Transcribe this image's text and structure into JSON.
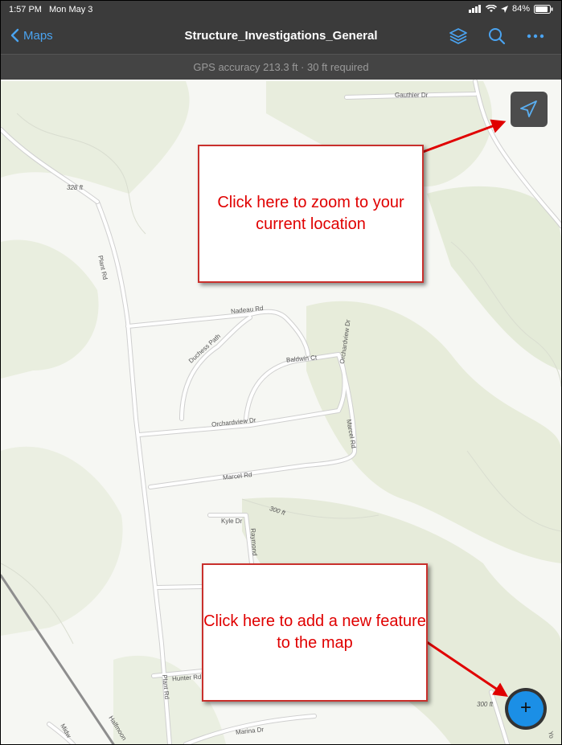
{
  "status_bar": {
    "time": "1:57 PM",
    "date": "Mon May 3",
    "battery": "84%"
  },
  "nav": {
    "back_label": "Maps",
    "title": "Structure_Investigations_General"
  },
  "gps": {
    "text": "GPS accuracy 213.3 ft  ·  30 ft required"
  },
  "map": {
    "roads": [
      "Gauthier Dr",
      "Plant Rd",
      "Nadeau Rd",
      "Duchess Path",
      "Baldwin Ct",
      "Orchardview Dr",
      "Orchardview Dr",
      "Marcel Rd",
      "Marcel Rd",
      "Kyle Dr",
      "Raymond",
      "Hunter Rd",
      "Plant Rd",
      "Marina Dr",
      "Halfmoon",
      "Midw",
      "Yo"
    ],
    "elevations": [
      "328 ft",
      "300 ft",
      "300 ft"
    ]
  },
  "callouts": {
    "locate": "Click here to zoom to your current location",
    "add": "Click here to add a new feature to the map"
  },
  "buttons": {
    "add_symbol": "+"
  },
  "colors": {
    "accent": "#1b8fe6",
    "annotation": "#e00000"
  }
}
